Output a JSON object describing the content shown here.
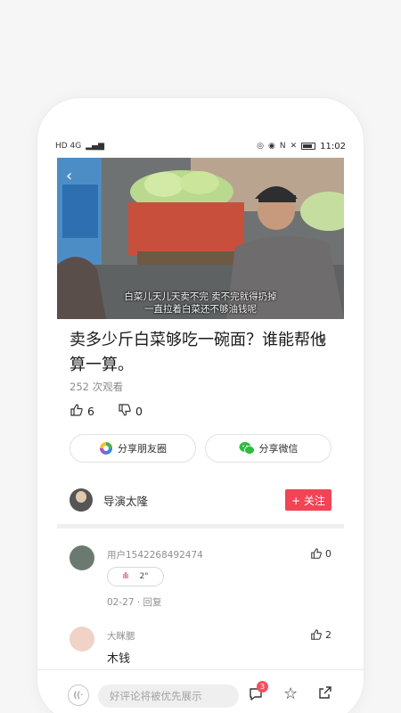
{
  "status_bar": {
    "signal": "HD 4G",
    "time": "11:02"
  },
  "video": {
    "back_icon": "back-chevron-icon",
    "subtitle_line1": "白菜儿天儿天卖不完 卖不完就得扔掉",
    "subtitle_line2": "一直拉着白菜还不够油钱呢"
  },
  "article": {
    "title": "卖多少斤白菜够吃一碗面？谁能帮他算一算。",
    "views": "252 次观看",
    "likes": "6",
    "dislikes": "0"
  },
  "share": {
    "moments_label": "分享朋友圈",
    "wechat_label": "分享微信"
  },
  "author": {
    "name": "导演太隆",
    "follow_label": "+ 关注"
  },
  "comments": [
    {
      "user": "用户1542268492474",
      "likes": "0",
      "voice_duration": "2\"",
      "meta": "02-27 · 回复"
    },
    {
      "user": "大眯腮",
      "likes": "2",
      "text": "木钱"
    }
  ],
  "bottom_bar": {
    "placeholder": "好评论将被优先展示",
    "comment_count": "3"
  },
  "colors": {
    "accent": "#f14455"
  }
}
